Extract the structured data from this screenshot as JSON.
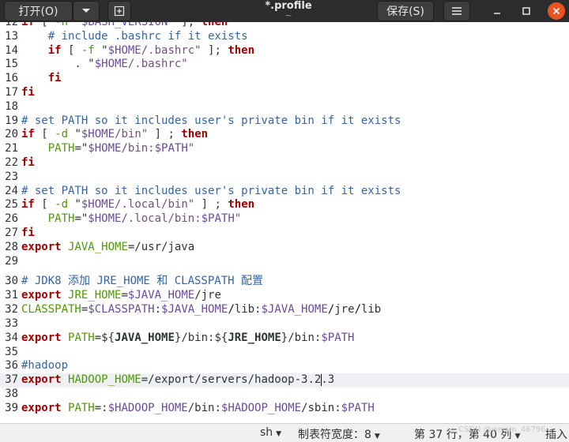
{
  "header": {
    "open_label": "打开(O)",
    "open_arrow_icon": "chevron-down-icon",
    "new_tab_icon": "new-document-icon",
    "title": "*.profile",
    "subtitle": "~",
    "save_label": "保存(S)",
    "menu_icon": "hamburger-menu-icon",
    "minimize_icon": "minimize-icon",
    "maximize_icon": "maximize-icon",
    "close_icon": "close-icon"
  },
  "editor": {
    "lines": [
      {
        "n": "12",
        "tokens": [
          {
            "t": "if",
            "c": "kw"
          },
          {
            "t": " [ "
          },
          {
            "t": "-n",
            "c": "bi"
          },
          {
            "t": " \""
          },
          {
            "t": "$BASH_VERSION",
            "c": "var"
          },
          {
            "t": "\" ]; "
          },
          {
            "t": "then",
            "c": "kw"
          }
        ]
      },
      {
        "n": "13",
        "tokens": [
          {
            "t": "    "
          },
          {
            "t": "# include .bashrc if it exists",
            "c": "cm"
          }
        ]
      },
      {
        "n": "14",
        "tokens": [
          {
            "t": "    "
          },
          {
            "t": "if",
            "c": "kw"
          },
          {
            "t": " [ "
          },
          {
            "t": "-f",
            "c": "bi"
          },
          {
            "t": " \""
          },
          {
            "t": "$HOME",
            "c": "var"
          },
          {
            "t": "/.bashrc\"",
            "c": "str"
          },
          {
            "t": " ]; "
          },
          {
            "t": "then",
            "c": "kw"
          }
        ]
      },
      {
        "n": "15",
        "tokens": [
          {
            "t": "        . \""
          },
          {
            "t": "$HOME",
            "c": "var"
          },
          {
            "t": "/.bashrc\"",
            "c": "str"
          }
        ]
      },
      {
        "n": "16",
        "tokens": [
          {
            "t": "    "
          },
          {
            "t": "fi",
            "c": "kw"
          }
        ]
      },
      {
        "n": "17",
        "tokens": [
          {
            "t": "fi",
            "c": "kw"
          }
        ]
      },
      {
        "n": "18",
        "tokens": []
      },
      {
        "n": "19",
        "tokens": [
          {
            "t": "# set PATH so it includes user's private bin if it exists",
            "c": "cm"
          }
        ]
      },
      {
        "n": "20",
        "tokens": [
          {
            "t": "if",
            "c": "kw"
          },
          {
            "t": " [ "
          },
          {
            "t": "-d",
            "c": "bi"
          },
          {
            "t": " \""
          },
          {
            "t": "$HOME",
            "c": "var"
          },
          {
            "t": "/bin\"",
            "c": "str"
          },
          {
            "t": " ] ; "
          },
          {
            "t": "then",
            "c": "kw"
          }
        ]
      },
      {
        "n": "21",
        "tokens": [
          {
            "t": "    "
          },
          {
            "t": "PATH",
            "c": "bi"
          },
          {
            "t": "=\""
          },
          {
            "t": "$HOME",
            "c": "var"
          },
          {
            "t": "/bin:",
            "c": "str"
          },
          {
            "t": "$PATH",
            "c": "var"
          },
          {
            "t": "\"",
            "c": "str"
          }
        ]
      },
      {
        "n": "22",
        "tokens": [
          {
            "t": "fi",
            "c": "kw"
          }
        ]
      },
      {
        "n": "23",
        "tokens": []
      },
      {
        "n": "24",
        "tokens": [
          {
            "t": "# set PATH so it includes user's private bin if it exists",
            "c": "cm"
          }
        ]
      },
      {
        "n": "25",
        "tokens": [
          {
            "t": "if",
            "c": "kw"
          },
          {
            "t": " [ "
          },
          {
            "t": "-d",
            "c": "bi"
          },
          {
            "t": " \""
          },
          {
            "t": "$HOME",
            "c": "var"
          },
          {
            "t": "/.local/bin\"",
            "c": "str"
          },
          {
            "t": " ] ; "
          },
          {
            "t": "then",
            "c": "kw"
          }
        ]
      },
      {
        "n": "26",
        "tokens": [
          {
            "t": "    "
          },
          {
            "t": "PATH",
            "c": "bi"
          },
          {
            "t": "=\""
          },
          {
            "t": "$HOME",
            "c": "var"
          },
          {
            "t": "/.local/bin:",
            "c": "str"
          },
          {
            "t": "$PATH",
            "c": "var"
          },
          {
            "t": "\"",
            "c": "str"
          }
        ]
      },
      {
        "n": "27",
        "tokens": [
          {
            "t": "fi",
            "c": "kw"
          }
        ]
      },
      {
        "n": "28",
        "tokens": [
          {
            "t": "export",
            "c": "kw"
          },
          {
            "t": " "
          },
          {
            "t": "JAVA_HOME",
            "c": "bi"
          },
          {
            "t": "=/usr/java"
          }
        ]
      },
      {
        "n": "29",
        "tokens": []
      },
      {
        "n": "30",
        "tall": true,
        "tokens": [
          {
            "t": "# JDK8 添加 JRE_HOME 和 CLASSPATH 配置",
            "c": "cm"
          }
        ]
      },
      {
        "n": "31",
        "tokens": [
          {
            "t": "export",
            "c": "kw"
          },
          {
            "t": " "
          },
          {
            "t": "JRE_HOME",
            "c": "bi"
          },
          {
            "t": "="
          },
          {
            "t": "$JAVA_HOME",
            "c": "var"
          },
          {
            "t": "/jre"
          }
        ]
      },
      {
        "n": "32",
        "tokens": [
          {
            "t": "CLASSPATH",
            "c": "bi"
          },
          {
            "t": "="
          },
          {
            "t": "$CLASSPATH",
            "c": "var"
          },
          {
            "t": ":"
          },
          {
            "t": "$JAVA_HOME",
            "c": "var"
          },
          {
            "t": "/",
            "c": "bd"
          },
          {
            "t": "lib:"
          },
          {
            "t": "$JAVA_HOME",
            "c": "var"
          },
          {
            "t": "/",
            "c": "bd"
          },
          {
            "t": "jre"
          },
          {
            "t": "/",
            "c": "bd"
          },
          {
            "t": "lib"
          }
        ]
      },
      {
        "n": "33",
        "tokens": []
      },
      {
        "n": "34",
        "tokens": [
          {
            "t": "export",
            "c": "kw"
          },
          {
            "t": " "
          },
          {
            "t": "PATH",
            "c": "bi"
          },
          {
            "t": "=${"
          },
          {
            "t": "JAVA_HOME",
            "c": "bd"
          },
          {
            "t": "}/bin:${"
          },
          {
            "t": "JRE_HOME",
            "c": "bd"
          },
          {
            "t": "}/bin:"
          },
          {
            "t": "$PATH",
            "c": "var"
          }
        ]
      },
      {
        "n": "35",
        "tokens": []
      },
      {
        "n": "36",
        "tokens": [
          {
            "t": "#hadoop",
            "c": "cm"
          }
        ]
      },
      {
        "n": "37",
        "current": true,
        "caret_after": 15,
        "tokens": [
          {
            "t": "export",
            "c": "kw"
          },
          {
            "t": " "
          },
          {
            "t": "HADOOP_HOME",
            "c": "bi"
          },
          {
            "t": "=/export/servers/hadoop-3.2"
          },
          {
            "t": "",
            "caret": true
          },
          {
            "t": ".3"
          }
        ]
      },
      {
        "n": "38",
        "tokens": []
      },
      {
        "n": "39",
        "tokens": [
          {
            "t": "export",
            "c": "kw"
          },
          {
            "t": " "
          },
          {
            "t": "PATH",
            "c": "bi"
          },
          {
            "t": "=:"
          },
          {
            "t": "$HADOOP_HOME",
            "c": "var"
          },
          {
            "t": "/bin:"
          },
          {
            "t": "$HADOOP_HOME",
            "c": "var"
          },
          {
            "t": "/sbin:"
          },
          {
            "t": "$PATH",
            "c": "var"
          }
        ]
      }
    ]
  },
  "status": {
    "language": "sh",
    "tab_width": "制表符宽度：8",
    "position": "第 37 行，第 40 列",
    "mode": "插入",
    "watermark": "CSDN @weixin_46796",
    "dropdown_icon": "triangle-down-icon"
  }
}
